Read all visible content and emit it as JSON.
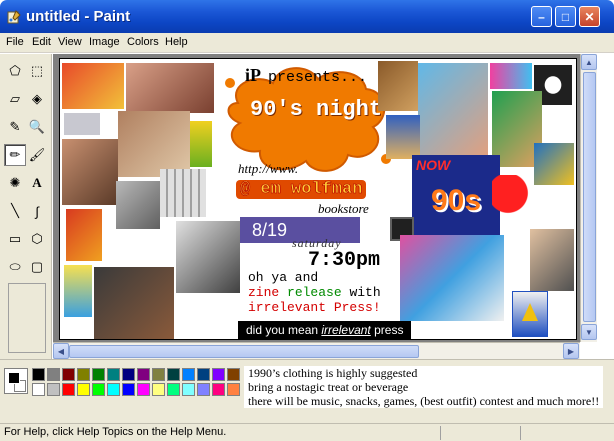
{
  "window": {
    "title": "untitled - Paint",
    "minimize_glyph": "–",
    "maximize_glyph": "□",
    "close_glyph": "✕"
  },
  "menu": [
    "File",
    "Edit",
    "View",
    "Image",
    "Colors",
    "Help"
  ],
  "tools": [
    {
      "name": "free-form-select-icon",
      "glyph": "⬠"
    },
    {
      "name": "select-icon",
      "glyph": "⬚"
    },
    {
      "name": "eraser-icon",
      "glyph": "▱"
    },
    {
      "name": "fill-icon",
      "glyph": "◈"
    },
    {
      "name": "pick-color-icon",
      "glyph": "✎"
    },
    {
      "name": "magnifier-icon",
      "glyph": "🔍"
    },
    {
      "name": "pencil-icon",
      "glyph": "✏"
    },
    {
      "name": "brush-icon",
      "glyph": "🖌"
    },
    {
      "name": "airbrush-icon",
      "glyph": "✺"
    },
    {
      "name": "text-icon",
      "glyph": "A"
    },
    {
      "name": "line-icon",
      "glyph": "╲"
    },
    {
      "name": "curve-icon",
      "glyph": "∫"
    },
    {
      "name": "rectangle-icon",
      "glyph": "▭"
    },
    {
      "name": "polygon-icon",
      "glyph": "⬡"
    },
    {
      "name": "ellipse-icon",
      "glyph": "⬭"
    },
    {
      "name": "rounded-rectangle-icon",
      "glyph": "▢"
    }
  ],
  "selected_tool": "pencil-icon",
  "canvas": {
    "logo": "iP",
    "presents": "presents...",
    "event": "90's night",
    "url": "http://www.",
    "venue": "@ em wolfman",
    "venue_sub": "bookstore",
    "date": "8/19",
    "day": "saturday",
    "time": "7:30pm",
    "line1": "oh ya and",
    "line2_a": "zine",
    "line2_b": "release",
    "line2_c": "with",
    "line3": "irrelevant Press!",
    "did_you_mean_prefix": "did you mean",
    "did_you_mean_word": "irrelevant",
    "did_you_mean_suffix": "press",
    "now_label": "NOW",
    "ninety": "90s"
  },
  "palette": {
    "foreground": "#000000",
    "background": "#ffffff",
    "colors": [
      "#000000",
      "#808080",
      "#800000",
      "#808000",
      "#008000",
      "#008080",
      "#000080",
      "#800080",
      "#808040",
      "#004040",
      "#0080ff",
      "#004080",
      "#8000ff",
      "#804000",
      "#ffffff",
      "#c0c0c0",
      "#ff0000",
      "#ffff00",
      "#00ff00",
      "#00ffff",
      "#0000ff",
      "#ff00ff",
      "#ffff80",
      "#00ff80",
      "#80ffff",
      "#8080ff",
      "#ff0080",
      "#ff8040"
    ]
  },
  "message": [
    "1990’s clothing is highly suggested",
    "bring a nostagic treat or beverage",
    "there will be music, snacks, games, (best outfit) contest and much more!!"
  ],
  "status": "For Help, click Help Topics on the Help Menu.",
  "colors": {
    "title_blue": "#0c45c4",
    "chrome": "#ece9d8",
    "splat_orange": "#f07a00"
  }
}
